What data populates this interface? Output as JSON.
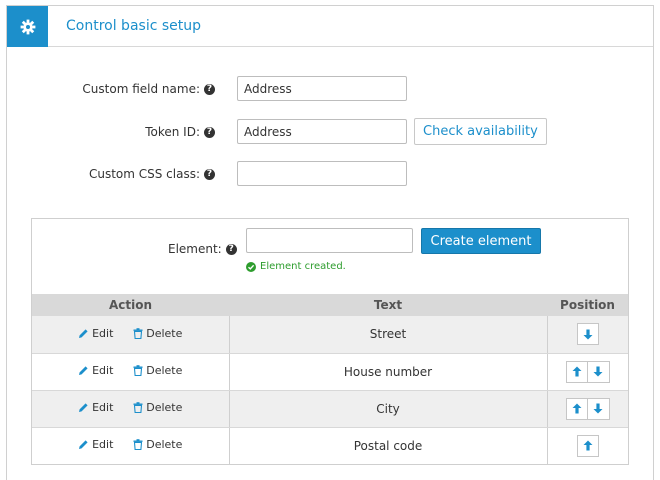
{
  "header": {
    "title": "Control basic setup",
    "icon": "gear-icon"
  },
  "form": {
    "custom_field_name": {
      "label": "Custom field name:",
      "value": "Address"
    },
    "token_id": {
      "label": "Token ID:",
      "value": "Address",
      "check_label": "Check availability"
    },
    "custom_css_class": {
      "label": "Custom CSS class:",
      "value": ""
    }
  },
  "element": {
    "label": "Element:",
    "value": "",
    "create_label": "Create element",
    "message": "Element created."
  },
  "table": {
    "headers": {
      "action": "Action",
      "text": "Text",
      "position": "Position"
    },
    "edit_label": "Edit",
    "delete_label": "Delete",
    "rows": [
      {
        "text": "Street"
      },
      {
        "text": "House number"
      },
      {
        "text": "City"
      },
      {
        "text": "Postal code"
      }
    ]
  },
  "colors": {
    "accent": "#1c8fcb",
    "success": "#2e9d2e"
  }
}
